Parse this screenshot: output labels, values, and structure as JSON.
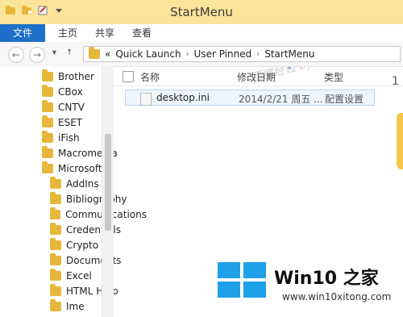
{
  "window": {
    "title": "StartMenu",
    "qat_icons": [
      "folder-icon",
      "new-folder-icon",
      "properties-icon",
      "dropdown-arrow-icon"
    ]
  },
  "ribbon": {
    "tabs": [
      "文件",
      "主页",
      "共享",
      "查看"
    ]
  },
  "watermark_top": "百度经验 by Kg9928",
  "address": {
    "prefix": "«",
    "crumbs": [
      "Quick Launch",
      "User Pinned",
      "StartMenu"
    ]
  },
  "tree": {
    "items": [
      "Brother",
      "CBox",
      "CNTV",
      "ESET",
      "iFish",
      "Macromedia",
      "Microsoft",
      "AddIns",
      "Bibliography",
      "Communications",
      "Credentials",
      "Crypto",
      "Documents",
      "Excel",
      "HTML Help",
      "Ime"
    ]
  },
  "list": {
    "columns": [
      "名称",
      "修改日期",
      "类型"
    ],
    "rows": [
      {
        "name": "desktop.ini",
        "modified": "2014/2/21 周五 ...",
        "type": "配置设置"
      }
    ]
  },
  "right_count": "1",
  "branding": {
    "logo_icon": "windows-logo-icon",
    "title": "Win10 之家",
    "url": "www.win10xitong.com",
    "colors": {
      "blue": "#1ea0e6"
    }
  }
}
